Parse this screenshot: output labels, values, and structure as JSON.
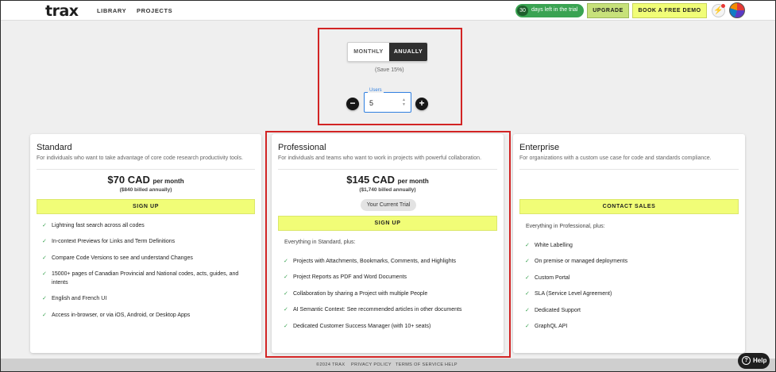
{
  "header": {
    "logo": "trax",
    "nav": [
      "LIBRARY",
      "PROJECTS"
    ],
    "trial_days": "30",
    "trial_text": "days left in the trial",
    "upgrade_label": "UPGRADE",
    "demo_label": "BOOK A FREE DEMO"
  },
  "billing": {
    "monthly_label": "MONTHLY",
    "annual_label": "ANUALLY",
    "selected": "ANUALLY",
    "save_note": "(Save 15%)",
    "users_label": "Users",
    "users_value": "5",
    "minus": "−",
    "plus": "+"
  },
  "plans": [
    {
      "name": "Standard",
      "description": "For individuals who want to take advantage of core code research productivity tools.",
      "price": "$70 CAD",
      "per": "per month",
      "billed": "($840 billed annually)",
      "cta": "SIGN UP",
      "features": [
        "Lightning fast search across all codes",
        "In-context Previews for Links and Term Definitions",
        "Compare Code Versions to see and understand Changes",
        "15000+ pages of Canadian Provincial and National codes, acts, guides, and intents",
        "English and French UI",
        "Access in-browser, or via iOS, Android, or Desktop Apps"
      ]
    },
    {
      "name": "Professional",
      "description": "For individuals and teams who want to work in projects with powerful collaboration.",
      "price": "$145 CAD",
      "per": "per month",
      "billed": "($1,740 billed annually)",
      "badge": "Your Current Trial",
      "cta": "SIGN UP",
      "intro": "Everything in Standard, plus:",
      "features": [
        "Projects with Attachments, Bookmarks, Comments, and Highlights",
        "Project Reports as PDF and Word Documents",
        "Collaboration by sharing a Project with multiple People",
        "AI Semantic Context: See recommended articles in other documents",
        "Dedicated Customer Success Manager (with 10+ seats)"
      ]
    },
    {
      "name": "Enterprise",
      "description": "For organizations with a custom use case for code and standards compliance.",
      "cta": "CONTACT SALES",
      "intro": "Everything in Professional, plus:",
      "features": [
        "White Labelling",
        "On premise or managed deployments",
        "Custom Portal",
        "SLA (Service Level Agreement)",
        "Dedicated Support",
        "GraphQL API"
      ]
    }
  ],
  "footer": {
    "copyright": "©2024 TRAX",
    "links": [
      "PRIVACY POLICY",
      "TERMS OF SERVICE",
      "HELP"
    ]
  },
  "help_label": "Help",
  "colors": {
    "accent_yellow": "#f1fd77",
    "upgrade_green": "#c7e17a",
    "trial_green": "#3aa352",
    "highlight_red": "#d22424",
    "dark": "#2f2f2f"
  },
  "icons": {
    "check": "check-icon",
    "bolt": "lightning-icon",
    "help": "help-icon"
  }
}
